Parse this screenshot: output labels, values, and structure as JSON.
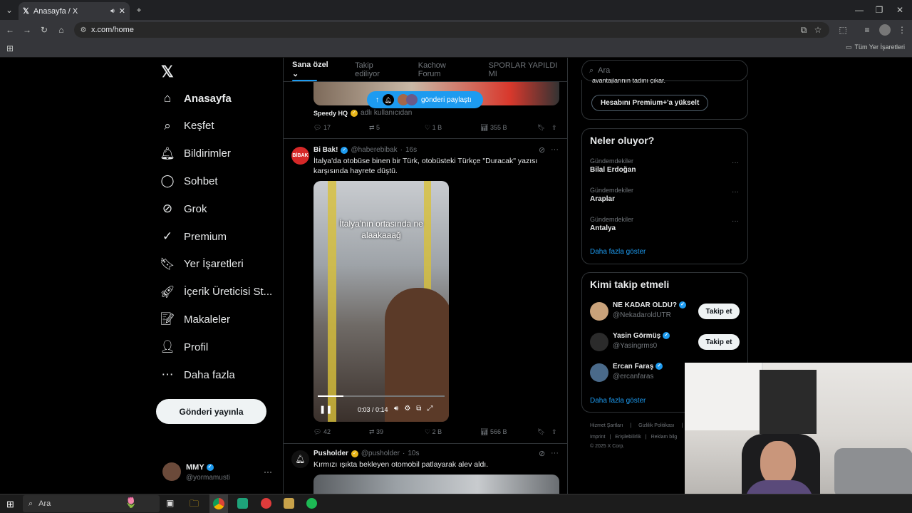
{
  "browser": {
    "tab_title": "Anasayfa / X",
    "url": "x.com/home",
    "bookmarks_label": "Tüm Yer İşaretleri"
  },
  "nav": {
    "items": [
      {
        "label": "Anasayfa",
        "icon": "home-icon"
      },
      {
        "label": "Keşfet",
        "icon": "search-icon"
      },
      {
        "label": "Bildirimler",
        "icon": "bell-icon"
      },
      {
        "label": "Sohbet",
        "icon": "chat-icon"
      },
      {
        "label": "Grok",
        "icon": "grok-icon"
      },
      {
        "label": "Premium",
        "icon": "premium-icon"
      },
      {
        "label": "Yer İşaretleri",
        "icon": "bookmark-icon"
      },
      {
        "label": "İçerik Üreticisi St...",
        "icon": "rocket-icon"
      },
      {
        "label": "Makaleler",
        "icon": "article-icon"
      },
      {
        "label": "Profil",
        "icon": "profile-icon"
      },
      {
        "label": "Daha fazla",
        "icon": "more-icon"
      }
    ],
    "post_button": "Gönderi yayınla",
    "account": {
      "name": "MMY",
      "handle": "@yormamusti"
    }
  },
  "timeline": {
    "tabs": [
      "Sana özel",
      "Takip ediliyor",
      "Kachow Forum",
      "SPORLAR YAPILDI MI"
    ],
    "share_pill": "gönderi paylaştı",
    "tweet0": {
      "name": "Speedy HQ",
      "sub": "adlı kullanıcıdan",
      "replies": "17",
      "reposts": "5",
      "likes": "1 B",
      "views": "355 B"
    },
    "tweet1": {
      "name": "Bi Bak!",
      "handle": "@haberebibak",
      "time": "16s",
      "text1": "İtalya'da otobüse binen bir Türk, otobüsteki Türkçe \"Duracak\" yazısı",
      "text2": "karşısında hayrete düştü.",
      "video_caption1": "İtalya'nın ortasında ne",
      "video_caption2": "alaakaaağ",
      "video_time": "0:03 / 0:14",
      "replies": "42",
      "reposts": "39",
      "likes": "2 B",
      "views": "566 B"
    },
    "tweet2": {
      "name": "Pusholder",
      "handle": "@pusholder",
      "time": "10s",
      "text": "Kırmızı ışıkta bekleyen otomobil patlayarak alev aldı."
    }
  },
  "right": {
    "search_placeholder": "Ara",
    "premium_cut": "avantajlarının tadını çıkar.",
    "premium_button": "Hesabını Premium+'a yükselt",
    "trends_title": "Neler oluyor?",
    "trends": [
      {
        "cat": "Gündemdekiler",
        "name": "Bilal Erdoğan"
      },
      {
        "cat": "Gündemdekiler",
        "name": "Araplar"
      },
      {
        "cat": "Gündemdekiler",
        "name": "Antalya"
      }
    ],
    "show_more": "Daha fazla göster",
    "who_title": "Kimi takip etmeli",
    "who": [
      {
        "name": "NE KADAR OLDU?",
        "handle": "@NekadaroldUTR",
        "btn": "Takip et"
      },
      {
        "name": "Yasin Görmüş",
        "handle": "@Yasingrms0",
        "btn": "Takip et"
      },
      {
        "name": "Ercan Faraş",
        "handle": "@ercanfaras",
        "btn": ""
      }
    ],
    "who_more": "Daha fazla göster",
    "footer1": [
      "Hizmet Şartları",
      "Gizlilik Politikası"
    ],
    "footer2": [
      "Imprint",
      "Erişilebilirlik",
      "Reklam bilg"
    ],
    "copyright": "© 2025 X Corp."
  },
  "taskbar": {
    "search": "Ara"
  },
  "colors": {
    "accent": "#1d9bf0",
    "bg": "#000000",
    "border": "#2f3336"
  }
}
